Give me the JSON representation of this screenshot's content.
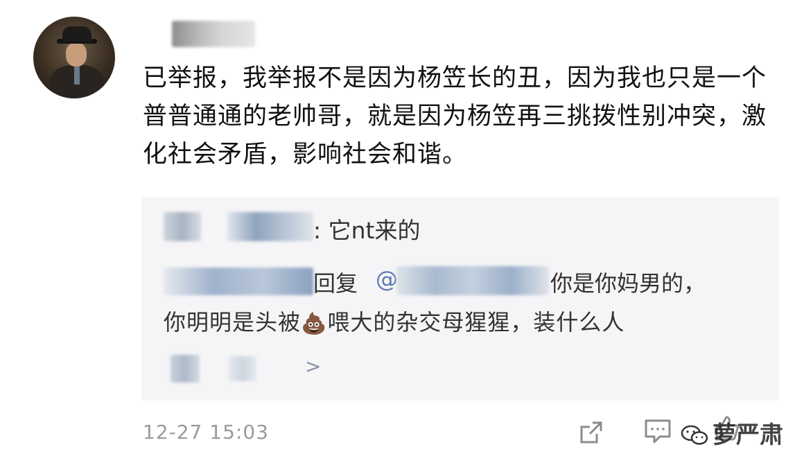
{
  "comment": {
    "body": "已举报，我举报不是因为杨笠长的丑，因为我也只是一个普普通通的老帅哥，就是因为杨笠再三挑拨性别冲突，激化社会矛盾，影响社会和谐。",
    "timestamp": "12-27 15:03"
  },
  "quoted": {
    "line1_suffix": ": 它nt来的",
    "reply_label": "回复",
    "at_symbol": "@",
    "reply_text_after": "你是你妈男的，",
    "line3_before": "你明明是头被",
    "emoji": "💩",
    "line3_after": "喂大的杂交母猩猩，装什么人",
    "more_arrow": ">"
  },
  "actions": {
    "share_icon": "share-icon",
    "comment_icon": "comment-icon",
    "like_icon": "like-icon"
  },
  "watermark": {
    "text": "萝严肃"
  }
}
